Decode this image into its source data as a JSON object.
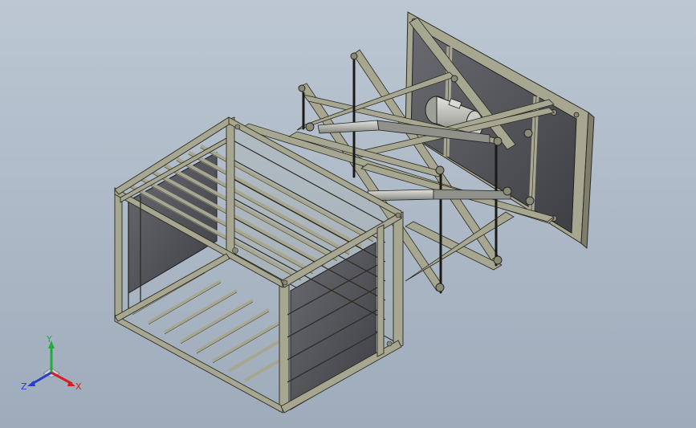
{
  "viewport": {
    "background_top": "#bcc7d3",
    "background_bottom": "#9eabba"
  },
  "model": {
    "frame_color": "#a7a690",
    "frame_edge": "#2b2b22",
    "panel_color": "#4f5055",
    "panel_edge": "#1f2024",
    "rod_color": "#1a1a1a",
    "cylinder_color": "#b9bbb4",
    "motor_color": "#c9ccc6"
  },
  "triad": {
    "y_label": "Y",
    "x_label": "X",
    "z_label": "Z",
    "y_color": "#1fae3a",
    "x_color": "#d62020",
    "z_color": "#2540c8"
  }
}
